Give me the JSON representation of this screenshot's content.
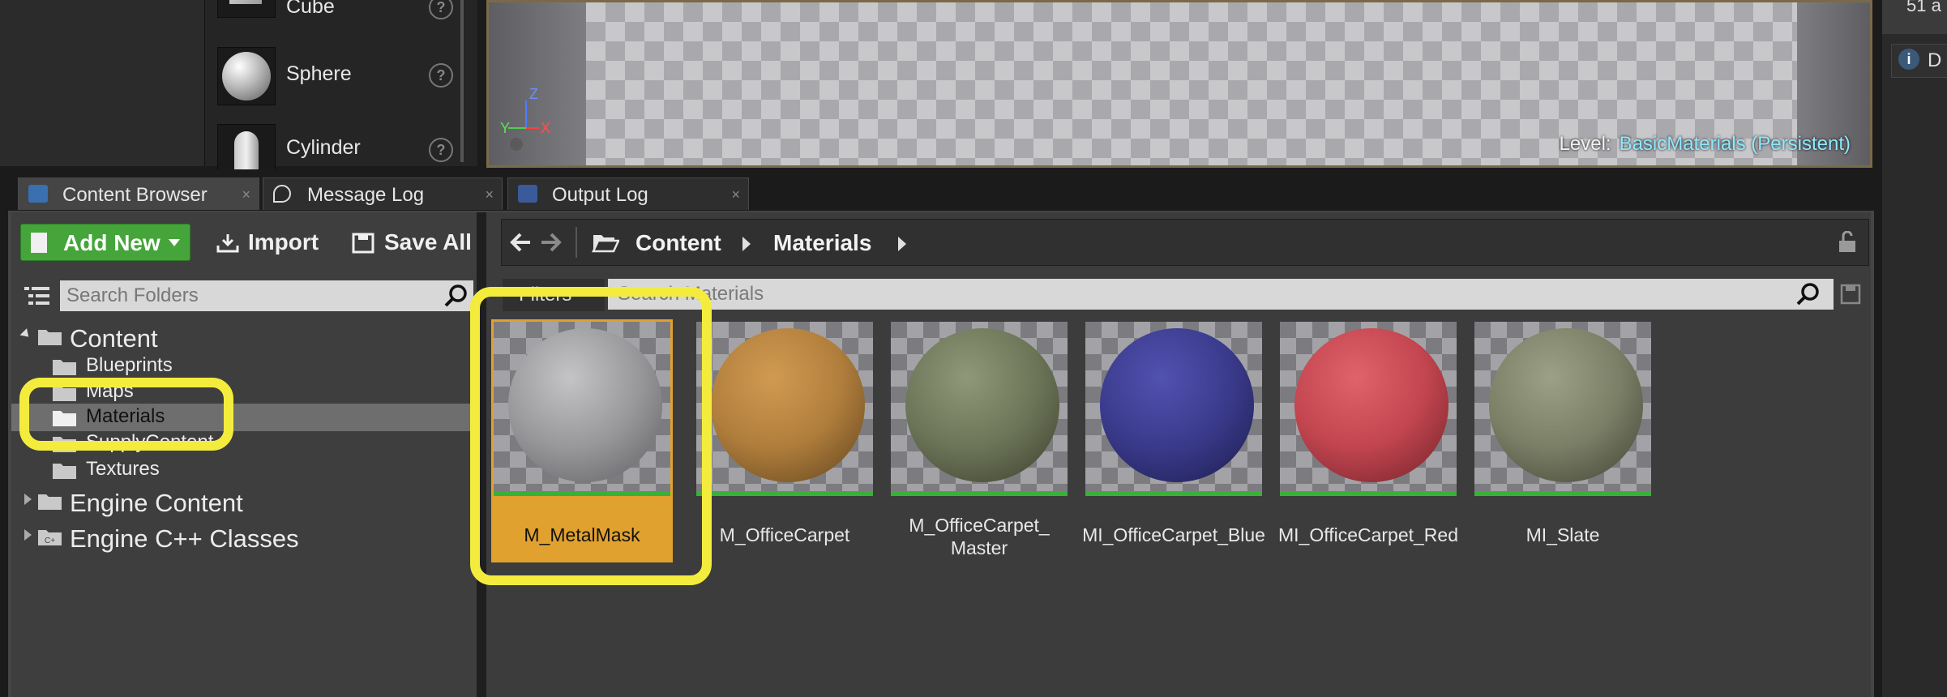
{
  "modes_panel": {
    "shapes": [
      "Cube",
      "Sphere",
      "Cylinder"
    ],
    "help_glyph": "?"
  },
  "viewport": {
    "level_prefix": "Level:",
    "level_name": "BasicMaterials (Persistent)",
    "axes": {
      "z": "Z",
      "y": "Y",
      "x": "X"
    }
  },
  "right_panel": {
    "top_text": "51 a",
    "tab_label": "D",
    "tab_glyph": "i"
  },
  "tabs": [
    {
      "label": "Content Browser",
      "icon": "content-browser-icon",
      "active": true
    },
    {
      "label": "Message Log",
      "icon": "message-log-icon",
      "active": false
    },
    {
      "label": "Output Log",
      "icon": "output-log-icon",
      "active": false
    }
  ],
  "tab_close_glyph": "×",
  "toolbar": {
    "add_new_label": "Add New",
    "import_label": "Import",
    "save_all_label": "Save All"
  },
  "folder_search": {
    "placeholder": "Search Folders"
  },
  "folder_tree": [
    {
      "label": "Content",
      "level": 0,
      "expanded": true
    },
    {
      "label": "Blueprints",
      "level": 1
    },
    {
      "label": "Maps",
      "level": 1
    },
    {
      "label": "Materials",
      "level": 1,
      "selected": true
    },
    {
      "label": "SupplyContent",
      "level": 1
    },
    {
      "label": "Textures",
      "level": 1
    },
    {
      "label": "Engine Content",
      "level": 0,
      "expanded": false
    },
    {
      "label": "Engine C++ Classes",
      "level": 0,
      "expanded": false
    }
  ],
  "breadcrumb": [
    "Content",
    "Materials"
  ],
  "filters_label": "Filters",
  "asset_search": {
    "placeholder": "Search Materials"
  },
  "assets": [
    {
      "name": "M_MetalMask",
      "color": "#9a9a9c",
      "selected": true
    },
    {
      "name": "M_OfficeCarpet",
      "color": "#b07e3c"
    },
    {
      "name": "M_OfficeCarpet_ Master",
      "color": "#6d7558"
    },
    {
      "name": "MI_OfficeCarpet_Blue",
      "color": "#3a3a8c"
    },
    {
      "name": "MI_OfficeCarpet_Red",
      "color": "#c2454f"
    },
    {
      "name": "MI_Slate",
      "color": "#7b7f66"
    }
  ],
  "colors": {
    "add_new_green": "#45a53a",
    "selection_orange": "#e0a12f",
    "callout_yellow": "#f4ec3d",
    "level_name_cyan": "#8fe9ff",
    "asset_underline_green": "#37b236"
  }
}
